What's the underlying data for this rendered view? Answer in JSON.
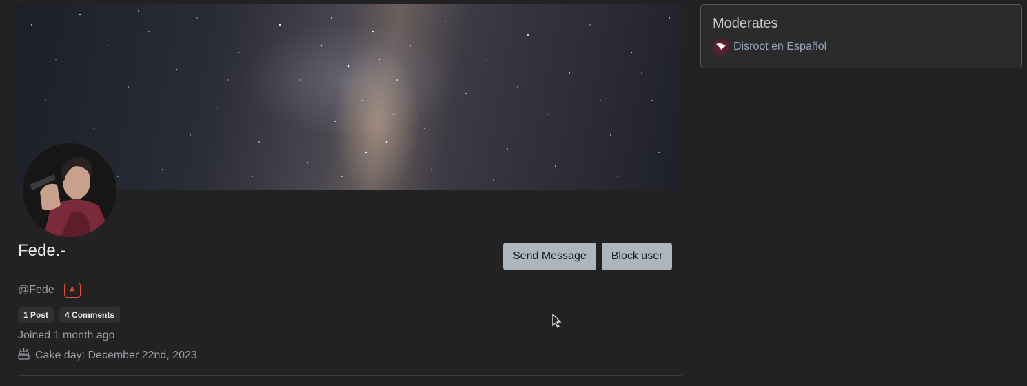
{
  "profile": {
    "display_name": "Fede.-",
    "handle": "@Fede",
    "admin_badge": "A",
    "stats": {
      "posts": "1 Post",
      "comments": "4 Comments"
    },
    "joined": "Joined 1 month ago",
    "cake_day": "Cake day: December 22nd, 2023",
    "icons": {
      "banner": "milky-way-banner",
      "avatar": "user-avatar",
      "cake": "birthday-cake-icon"
    }
  },
  "actions": {
    "send_message": "Send Message",
    "block_user": "Block user"
  },
  "sidebar": {
    "moderates_title": "Moderates",
    "communities": [
      {
        "name": "Disroot en Español",
        "icon": "disroot-community-icon"
      }
    ]
  },
  "colors": {
    "background": "#222222",
    "button": "#adb5bd",
    "admin_badge": "#e74c3c",
    "link": "#99a5bd",
    "card_border": "#595959"
  }
}
